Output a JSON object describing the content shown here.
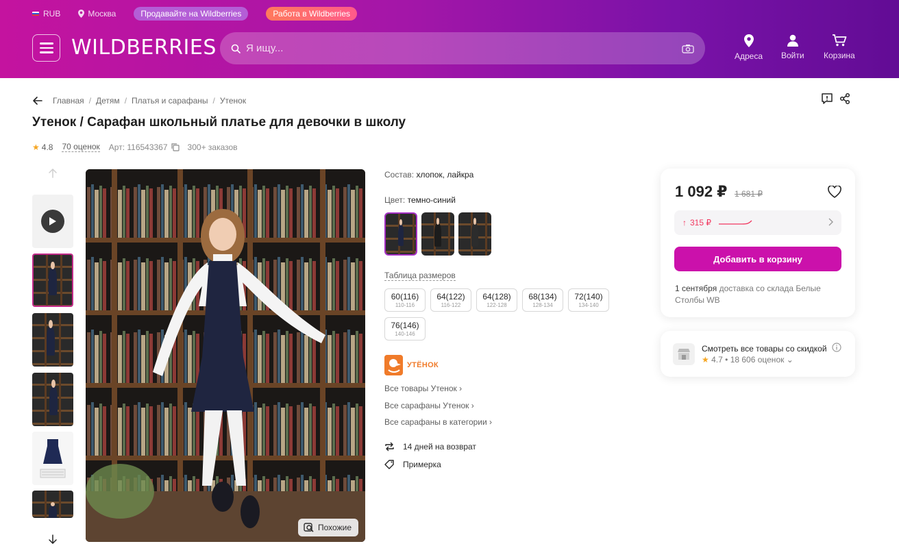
{
  "header": {
    "currency": "RUB",
    "city": "Москва",
    "sell_label": "Продавайте на Wildberries",
    "work_label": "Работа в Wildberries",
    "logo": "WILDBERRIES",
    "search_placeholder": "Я ищу...",
    "nav": {
      "addresses": "Адреса",
      "login": "Войти",
      "cart": "Корзина"
    }
  },
  "breadcrumbs": [
    "Главная",
    "Детям",
    "Платья и сарафаны",
    "Утенок"
  ],
  "product": {
    "title": "Утенок / Сарафан школьный платье для девочки в школу",
    "rating": "4.8",
    "reviews": "70 оценок",
    "article": "Арт: 116543367",
    "orders": "300+ заказов",
    "similar_label": "Похожие",
    "composition_label": "Состав:",
    "composition_value": "хлопок, лайкра",
    "color_label": "Цвет:",
    "color_value": "темно-синий",
    "size_table_label": "Таблица размеров",
    "sizes": [
      {
        "size": "60(116)",
        "height": "110-116"
      },
      {
        "size": "64(122)",
        "height": "116-122"
      },
      {
        "size": "64(128)",
        "height": "122-128"
      },
      {
        "size": "68(134)",
        "height": "128-134"
      },
      {
        "size": "72(140)",
        "height": "134-140"
      },
      {
        "size": "76(146)",
        "height": "140-146"
      }
    ],
    "brand": "УТЁНОК",
    "links": [
      "Все товары Утенок",
      "Все сарафаны Утенок",
      "Все сарафаны в категории"
    ],
    "features": [
      "14 дней на возврат",
      "Примерка"
    ]
  },
  "price_card": {
    "price": "1 092 ₽",
    "old_price": "1 681 ₽",
    "history": "315 ₽",
    "add_to_cart": "Добавить в корзину",
    "delivery_date": "1 сентября",
    "delivery_text": "доставка со склада Белые Столбы WB"
  },
  "shop_card": {
    "title": "Смотреть все товары со скидкой",
    "rating": "4.7",
    "reviews": "18 606 оценок"
  },
  "colors": {
    "brand": "#cb11ab",
    "price_up": "#f1375f",
    "brand_orange": "#f07b2a",
    "star": "#f5a623"
  }
}
